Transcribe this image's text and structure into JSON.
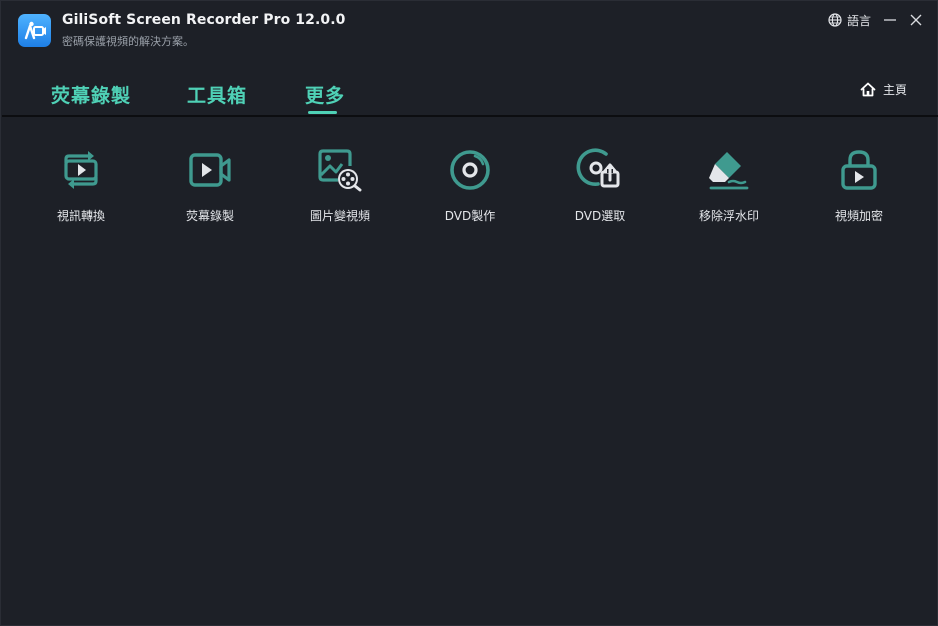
{
  "app": {
    "title": "GiliSoft Screen Recorder Pro 12.0.0",
    "subtitle": "密碼保護視頻的解決方案。"
  },
  "titlebar": {
    "language_label": "語言",
    "icons": [
      "globe-icon",
      "minimize-icon",
      "close-icon"
    ]
  },
  "tabs": [
    {
      "label": "荧幕錄製",
      "active": false
    },
    {
      "label": "工具箱",
      "active": false
    },
    {
      "label": "更多",
      "active": true
    }
  ],
  "home": {
    "label": "主頁",
    "icon": "home-icon"
  },
  "colors": {
    "background": "#1d2027",
    "accent": "#4fd1b6",
    "icon_teal": "#3f9a8f",
    "text": "#e4e6ea"
  },
  "tools": [
    {
      "label": "視訊轉換",
      "icon": "video-convert-icon"
    },
    {
      "label": "荧幕錄製",
      "icon": "screen-record-icon"
    },
    {
      "label": "圖片變視頻",
      "icon": "image-to-video-icon"
    },
    {
      "label": "DVD製作",
      "icon": "dvd-burn-icon"
    },
    {
      "label": "DVD選取",
      "icon": "dvd-rip-icon"
    },
    {
      "label": "移除浮水印",
      "icon": "remove-watermark-icon"
    },
    {
      "label": "視頻加密",
      "icon": "video-encrypt-icon"
    }
  ]
}
